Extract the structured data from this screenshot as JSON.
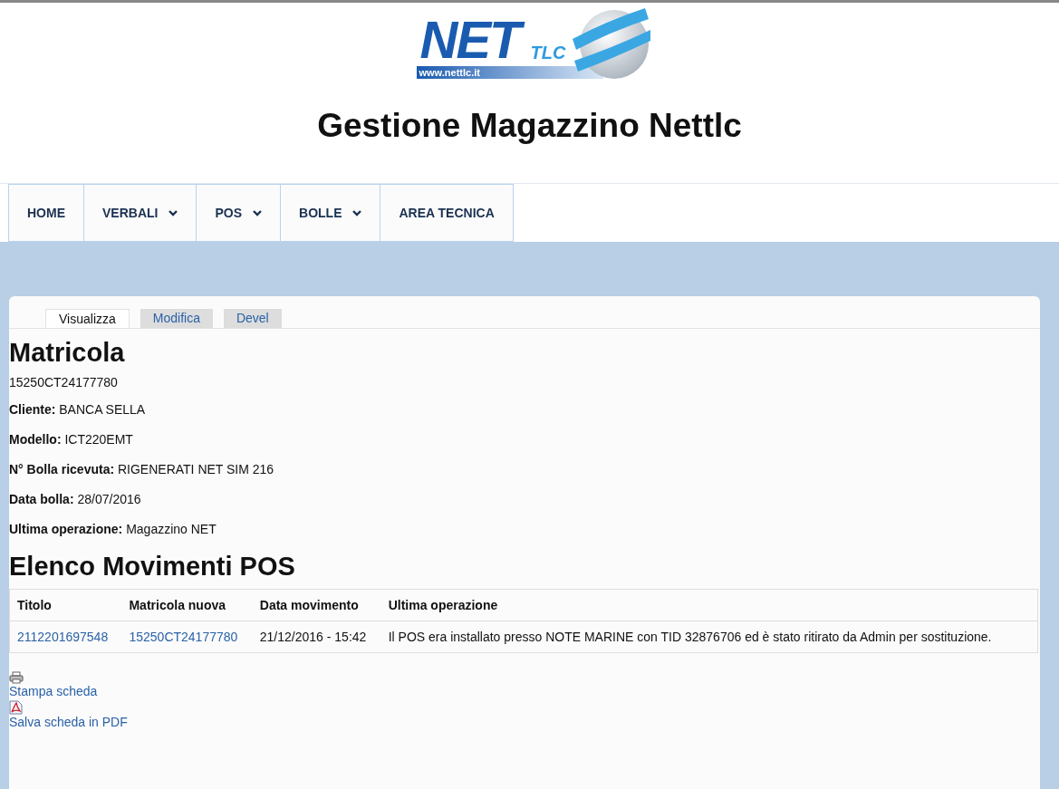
{
  "logo": {
    "brand": "NET",
    "sub": "TLC",
    "url": "www.nettlc.it"
  },
  "site_title": "Gestione Magazzino Nettlc",
  "nav": [
    {
      "label": "HOME",
      "dropdown": false
    },
    {
      "label": "VERBALI",
      "dropdown": true
    },
    {
      "label": "POS",
      "dropdown": true
    },
    {
      "label": "BOLLE",
      "dropdown": true
    },
    {
      "label": "AREA TECNICA",
      "dropdown": false
    }
  ],
  "tabs": [
    {
      "label": "Visualizza",
      "selected": true
    },
    {
      "label": "Modifica",
      "selected": false
    },
    {
      "label": "Devel",
      "selected": false
    }
  ],
  "title": "Matricola",
  "serial": "15250CT24177780",
  "fields": [
    {
      "label": "Cliente:",
      "value": "BANCA SELLA"
    },
    {
      "label": "Modello:",
      "value": "ICT220EMT"
    },
    {
      "label": "N° Bolla ricevuta:",
      "value": "RIGENERATI NET SIM 216"
    },
    {
      "label": "Data bolla:",
      "value": "28/07/2016"
    },
    {
      "label": "Ultima operazione:",
      "value": "Magazzino NET"
    }
  ],
  "movements": {
    "heading": "Elenco Movimenti POS",
    "columns": [
      {
        "label": "Titolo",
        "link": true
      },
      {
        "label": "Matricola nuova",
        "link": true
      },
      {
        "label": "Data movimento",
        "link": false
      },
      {
        "label": "Ultima operazione",
        "link": false
      }
    ],
    "rows": [
      [
        "2112201697548",
        "15250CT24177780",
        "21/12/2016 - 15:42",
        "Il POS era installato presso NOTE MARINE con TID 32876706 ed è stato ritirato da Admin per sostituzione."
      ]
    ]
  },
  "actions": [
    {
      "kind": "print",
      "label": "Stampa scheda"
    },
    {
      "kind": "pdf",
      "label": "Salva scheda in PDF"
    }
  ]
}
